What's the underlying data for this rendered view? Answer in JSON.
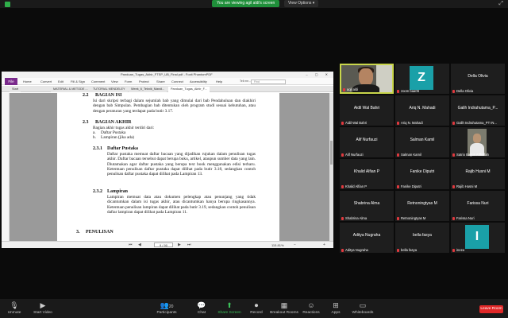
{
  "topbar": {
    "sharing_text": "You are viewing agil aldi's screen",
    "view_options": "View Options ▾"
  },
  "window": {
    "title": "Panduan_Tugas_Akhir_FTSP_UB_Final.pdf - Foxit PhantomPDF",
    "menu": [
      "File",
      "Home",
      "Convert",
      "Edit",
      "Fill & Sign",
      "Comment",
      "View",
      "Form",
      "Protect",
      "Share",
      "Connect",
      "Accessibility",
      "Help"
    ],
    "tell_me": "Tell me...",
    "search_placeholder": "Find",
    "tabs": [
      "Start",
      "MATERIAL & METODE ...",
      "TUTORIAL MENDELEY",
      "Week_6_Teknik_Mandi...",
      "Panduan_Tugas_Akhir_F..."
    ],
    "page_indicator": "9 / 90",
    "zoom": "115.81%"
  },
  "document": {
    "s22_num": "2.2",
    "s22_title": "BAGIAN ISI",
    "s22_body": "Isi dari skripsi terbagi dalam sejumlah bab yang dimulai dari bab Pendahuluan dan diakhiri dengan bab Simpulan. Pembagian bab ditentukan oleh program studi sesuai kebutuhan, atau dengan peraturan yang terdapat pada butir 3.17.",
    "s23_num": "2.3",
    "s23_title": "BAGIAN AKHIR",
    "s23_intro": "Bagian akhir tugas akhir terdiri dari:",
    "s23_a": "a.",
    "s23_a_text": "Daftar Pustaka",
    "s23_b": "b.",
    "s23_b_text": "Lampiran (jika ada)",
    "s231_num": "2.3.1",
    "s231_title": "Daftar Pustaka",
    "s231_body": "Daftar pustaka memuat daftar bacaan yang dijadikan rujukan dalam penulisan tugas akhir. Daftar bacaan tersebut dapat berupa buku, artikel, ataupun sumber data yang lain. Diutamakan agar daftar pustaka yang berupa text book menggunakan edisi terbaru. Ketentuan penulisan daftar pustaka dapat dilihat pada butir 3.18, sedangkan contoh penulisan daftar pustaka dapat dilihat pada Lampiran 13.",
    "s232_num": "2.3.2",
    "s232_title": "Lampiran",
    "s232_body": "Lampiran memuat data atau dokumen pelengkap atau penunjang yang tidak dicantumkan dalam isi tugas akhir, atau dicantumkan hanya berupa ringkasannya. Ketentuan penulisan lampiran dapat dilihat pada butir 3.19, sedangkan contoh penulisan daftar lampiran dapat dilihat pada Lampiran 11.",
    "s3_num": "3.",
    "s3_title": "PENULISAN"
  },
  "participants": [
    {
      "name": "",
      "label": "aqil aldi",
      "type": "video"
    },
    {
      "name": "",
      "label": "zoom baa06",
      "type": "avatar",
      "letter": "Z",
      "color": "#1aa0a8"
    },
    {
      "name": "Della Olivia",
      "label": "Della Olivia",
      "type": "name"
    },
    {
      "name": "Aidil Wal Bahri",
      "label": "Aidil Wal Bahri",
      "type": "name"
    },
    {
      "name": "Ariq N. Mahadi",
      "label": "Ariq N. Mahadi",
      "type": "name"
    },
    {
      "name": "Galih Indrahutama_P...",
      "label": "Galih Indrahutama_PT IN...",
      "type": "name"
    },
    {
      "name": "Alif Nurfauzi",
      "label": "Alif Nurfauzi",
      "type": "name"
    },
    {
      "name": "Salman Kamil",
      "label": "Salman Kamil",
      "type": "name"
    },
    {
      "name": "",
      "label": "Satrio Bagus Althallah",
      "type": "photo"
    },
    {
      "name": "Khalid Alfian P",
      "label": "Khalid Alfian P",
      "type": "name"
    },
    {
      "name": "Fanike Diputri",
      "label": "Fanike Diputri",
      "type": "name"
    },
    {
      "name": "Rajib Husni M",
      "label": "Rajib Husni M",
      "type": "name"
    },
    {
      "name": "Shabrina Alma",
      "label": "Shabrina Alma",
      "type": "name"
    },
    {
      "name": "Retnoningtyas M",
      "label": "Retnoningtyas M",
      "type": "name"
    },
    {
      "name": "Farissa Nuri",
      "label": "Farissa Nuri",
      "type": "name"
    },
    {
      "name": "Aditya Nugraha",
      "label": "Aditya Nugraha",
      "type": "name"
    },
    {
      "name": "bella fasya",
      "label": "bella fasya",
      "type": "name"
    },
    {
      "name": "",
      "label": "ineza",
      "type": "avatar",
      "letter": "I",
      "color": "#1aa0a8"
    }
  ],
  "toolbar": {
    "unmute": "Unmute",
    "start_video": "Start Video",
    "participants": "Participants",
    "participants_count": "20",
    "chat": "Chat",
    "share_screen": "Share Screen",
    "record": "Record",
    "breakout": "Breakout Rooms",
    "reactions": "Reactions",
    "apps": "Apps",
    "whiteboards": "Whiteboards",
    "leave": "Leave Room"
  },
  "colors": {
    "sharing_green": "#1f8f3a",
    "leave_red": "#e02828",
    "speaker_border": "#c9d64b",
    "foxit_purple": "#7a2a8c"
  }
}
